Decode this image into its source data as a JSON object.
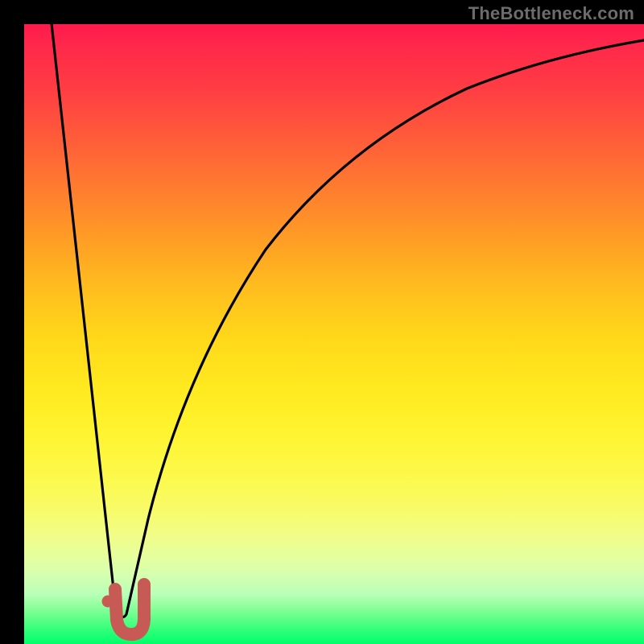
{
  "watermark": "TheBottleneck.com",
  "colors": {
    "background": "#000000",
    "curve_stroke": "#000000",
    "marker_stroke": "#c85a55",
    "marker_fill": "#c85a55",
    "gradient_top": "#ff1a4d",
    "gradient_bottom": "#00ff6a"
  },
  "chart_data": {
    "type": "line",
    "title": "",
    "xlabel": "",
    "ylabel": "",
    "xlim": [
      0,
      100
    ],
    "ylim": [
      0,
      100
    ],
    "grid": false,
    "legend": false,
    "series": [
      {
        "name": "bottleneck-curve",
        "x": [
          2,
          4,
          6,
          8,
          10,
          12,
          13,
          14,
          15,
          16,
          18,
          20,
          22,
          25,
          28,
          32,
          36,
          40,
          45,
          50,
          55,
          60,
          65,
          70,
          75,
          80,
          85,
          90,
          95,
          100
        ],
        "values": [
          100,
          84,
          68,
          52,
          36,
          20,
          12,
          4,
          0,
          4,
          18,
          30,
          40,
          52,
          60,
          68,
          74,
          78,
          82,
          85,
          87.5,
          89.5,
          91,
          92.2,
          93.2,
          94,
          94.6,
          95.2,
          95.7,
          96
        ]
      }
    ],
    "marker": {
      "name": "optimum-marker",
      "shape": "J",
      "color": "#c85a55",
      "dot_x": 13.2,
      "dot_y": 4.5,
      "hook_x_range": [
        14,
        18.5
      ],
      "hook_y_range": [
        0.5,
        8
      ]
    }
  }
}
